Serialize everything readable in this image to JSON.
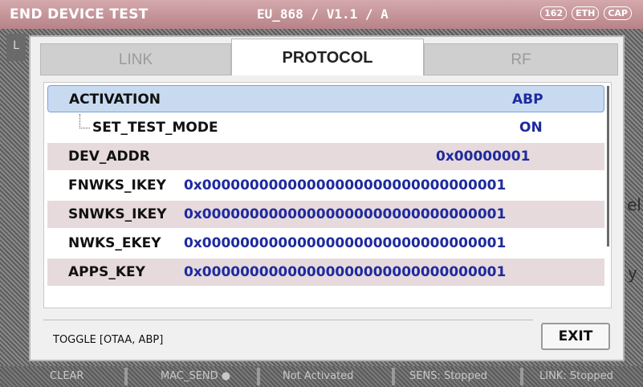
{
  "topbar": {
    "title": "END DEVICE TEST",
    "region_version": "EU_868 / V1.1 / A",
    "badge_1": "162",
    "badge_2": "ETH",
    "badge_3": "CAP"
  },
  "background": {
    "left_tab_letter": "L",
    "ghost_1": "el",
    "ghost_2": "y"
  },
  "tabs": [
    {
      "label": "LINK",
      "active": false
    },
    {
      "label": "PROTOCOL",
      "active": true
    },
    {
      "label": "RF",
      "active": false
    }
  ],
  "rows": [
    {
      "name": "ACTIVATION",
      "value": "ABP",
      "selected": true
    },
    {
      "name": "SET_TEST_MODE",
      "value": "ON",
      "child": true
    },
    {
      "name": "DEV_ADDR",
      "value": "0x00000001"
    },
    {
      "name": "FNWKS_IKEY",
      "value": "0x00000000000000000000000000000001"
    },
    {
      "name": "SNWKS_IKEY",
      "value": "0x00000000000000000000000000000001"
    },
    {
      "name": "NWKS_EKEY",
      "value": "0x00000000000000000000000000000001"
    },
    {
      "name": "APPS_KEY",
      "value": "0x00000000000000000000000000000001"
    }
  ],
  "hint": "TOGGLE [OTAA, ABP]",
  "exit_label": "EXIT",
  "statusbar": {
    "clear": "CLEAR",
    "mac_send": "MAC_SEND ●",
    "activation": "Not Activated",
    "sens": "SENS: Stopped",
    "link": "LINK: Stopped"
  },
  "colors": {
    "accent_value": "#1e2a9e",
    "selected_row": "#c8daf0",
    "shaded_row": "#e6dadd",
    "titlebar": "#c49498"
  }
}
